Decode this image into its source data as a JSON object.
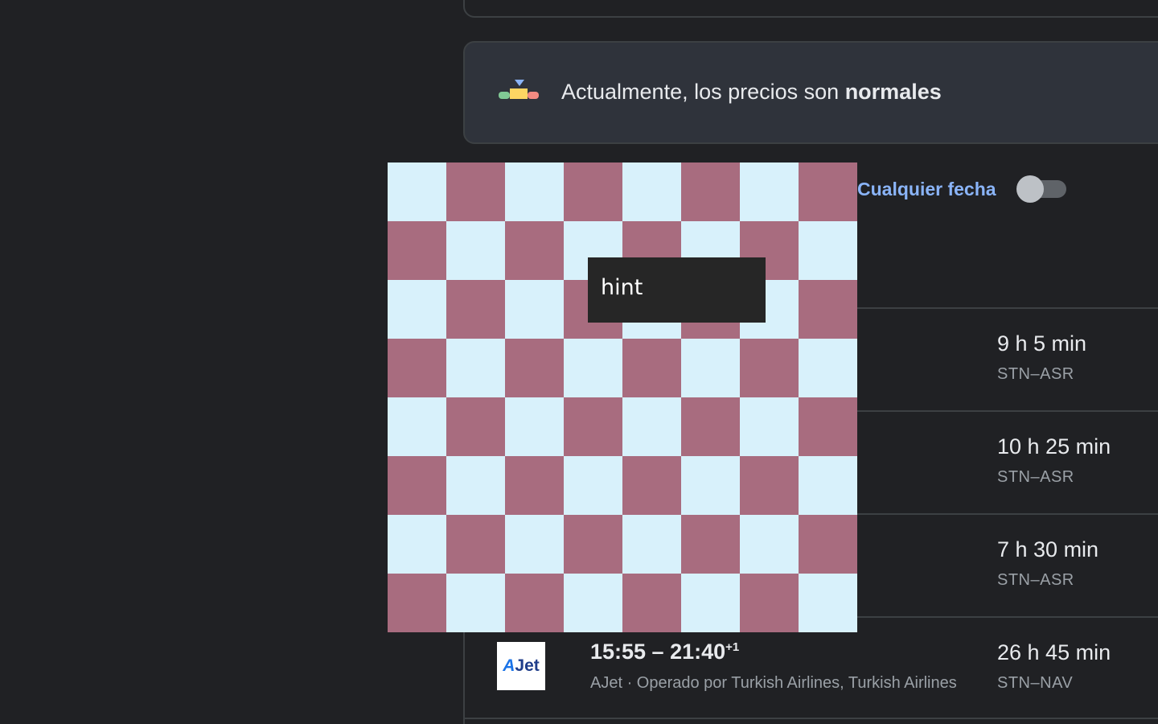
{
  "price_insight": {
    "text_prefix": "Actualmente, los precios son ",
    "text_emphasis": "normales",
    "icon": "price-level-indicator-icon",
    "colors": {
      "low": "#81c995",
      "typical": "#fdd663",
      "high": "#f28b82",
      "marker": "#8ab4f8"
    }
  },
  "filters": {
    "any_date_label": "Cualquier fecha",
    "any_date_enabled": false
  },
  "results": [
    {
      "times": "",
      "next_day": "",
      "airline": "",
      "duration": "9 h 5 min",
      "route": "STN–ASR"
    },
    {
      "times": "",
      "next_day": "",
      "airline": "",
      "duration": "10 h 25 min",
      "route": "STN–ASR"
    },
    {
      "times": "",
      "next_day": "",
      "airline": "",
      "duration": "7 h 30 min",
      "route": "STN–ASR"
    },
    {
      "times": "15:55 – 21:40",
      "next_day": "+1",
      "airline": "AJet · Operado por Turkish Airlines, Turkish Airlines",
      "logo_text_a": "A",
      "logo_text_rest": "Jet",
      "duration": "26 h 45 min",
      "route": "STN–NAV"
    }
  ],
  "overlay": {
    "hint_label": "hint",
    "checker_colors": {
      "light": "#d8f1fb",
      "dark": "#a86c7f"
    }
  }
}
